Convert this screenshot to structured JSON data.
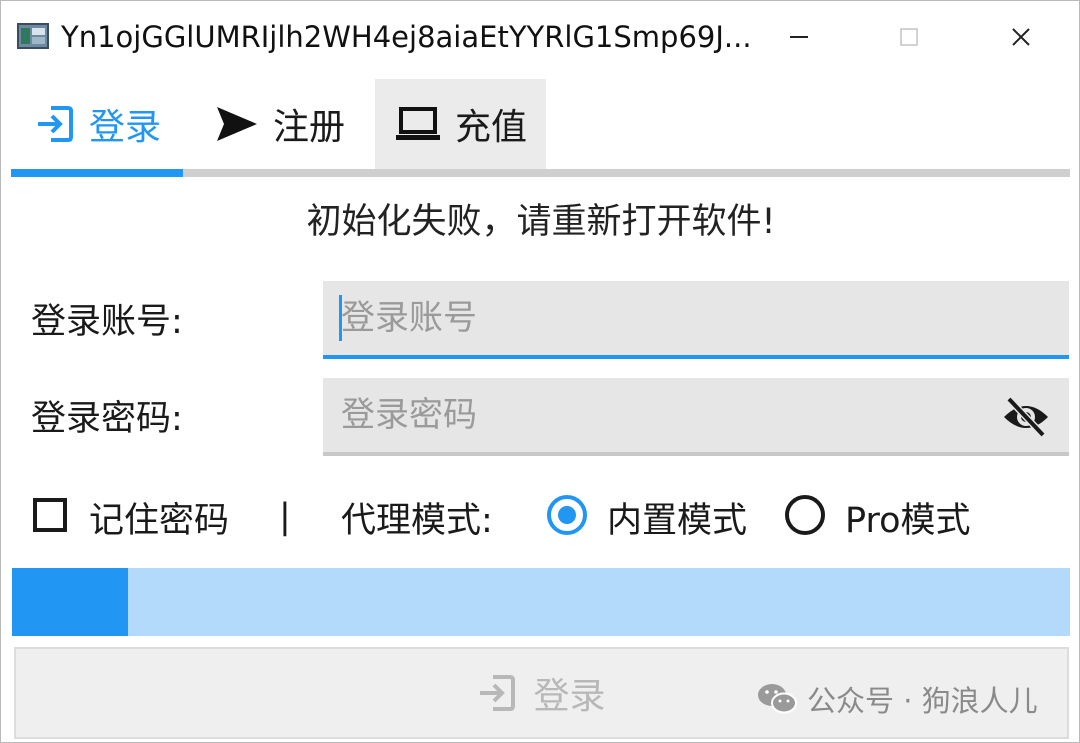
{
  "window": {
    "title": "Yn1ojGGlUMRIjlh2WH4ej8aiaEtYYRlG1Smp69J...",
    "icons": {
      "app": "app-window-icon",
      "minimize": "minimize-icon",
      "maximize": "maximize-icon",
      "close": "close-icon"
    }
  },
  "tabs": [
    {
      "label": "登录",
      "icon": "login-arrow-icon",
      "active": true
    },
    {
      "label": "注册",
      "icon": "send-icon",
      "active": false
    },
    {
      "label": "充值",
      "icon": "laptop-icon",
      "active": false
    }
  ],
  "message": "初始化失败，请重新打开软件!",
  "form": {
    "account_label": "登录账号:",
    "account_placeholder": "登录账号",
    "account_value": "",
    "password_label": "登录密码:",
    "password_placeholder": "登录密码",
    "password_value": "",
    "password_toggle_icon": "eye-off-icon"
  },
  "options": {
    "remember_label": "记住密码",
    "remember_checked": false,
    "separator": "|",
    "proxy_label": "代理模式:",
    "proxy_modes": [
      {
        "label": "内置模式",
        "selected": true
      },
      {
        "label": "Pro模式",
        "selected": false
      }
    ]
  },
  "progress": {
    "value": 0.11
  },
  "login_button": {
    "label": "登录",
    "icon": "login-arrow-icon",
    "enabled": false
  },
  "watermark": {
    "text": "公众号 · 狗浪人儿",
    "icon": "wechat-icon"
  },
  "colors": {
    "accent": "#2196f3",
    "accent_light": "#b3dafb",
    "input_bg": "#e6e6e6",
    "disabled_text": "#b8b8b8"
  }
}
